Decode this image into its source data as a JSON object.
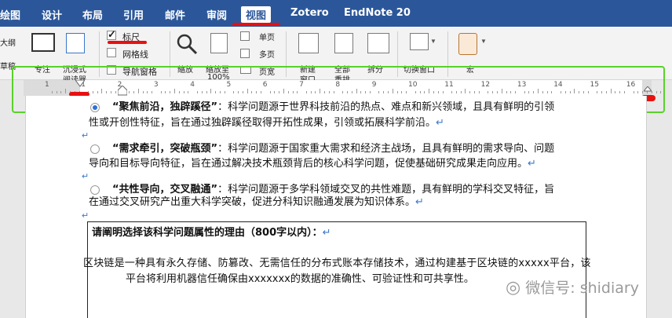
{
  "menu": {
    "items": [
      {
        "id": "draw",
        "label": "绘图"
      },
      {
        "id": "design",
        "label": "设计"
      },
      {
        "id": "layout",
        "label": "布局"
      },
      {
        "id": "references",
        "label": "引用"
      },
      {
        "id": "mailings",
        "label": "邮件"
      },
      {
        "id": "review",
        "label": "审阅"
      },
      {
        "id": "view",
        "label": "视图",
        "active": true
      },
      {
        "id": "zotero",
        "label": "Zotero"
      },
      {
        "id": "endnote",
        "label": "EndNote 20"
      }
    ]
  },
  "ribbon": {
    "outline_partial": "大纲",
    "draft_partial": "草稿",
    "focus": "专注",
    "immersive_reader_l1": "沉浸式",
    "immersive_reader_l2": "阅读器",
    "ruler": {
      "label": "标尺",
      "checked": true
    },
    "gridlines": {
      "label": "网格线",
      "checked": false
    },
    "nav_pane": {
      "label": "导航窗格",
      "checked": false
    },
    "zoom": "缩放",
    "zoom_to_l1": "缩放至",
    "zoom_to_l2": "100%",
    "one_page": "单页",
    "multi_page": "多页",
    "page_width": "页宽",
    "new_window_l1": "新建",
    "new_window_l2": "窗口",
    "arrange_all_l1": "全部",
    "arrange_all_l2": "重排",
    "split": "拆分",
    "switch_windows": "切换窗口",
    "macros": "宏"
  },
  "ruler": {
    "numbers": [
      "1",
      "1",
      "2",
      "3",
      "4",
      "5",
      "6",
      "7",
      "8",
      "9",
      "10",
      "11",
      "12",
      "13",
      "14",
      "15",
      "16"
    ]
  },
  "document": {
    "option1": {
      "title": "“聚焦前沿，独辟蹊径”",
      "line1_rest": "：科学问题源于世界科技前沿的热点、难点和新兴领域，且具有鲜明的引领",
      "line2": "性或开创性特征，旨在通过独辟蹊径取得开拓性成果，引领或拓展科学前沿。",
      "selected": true
    },
    "option2": {
      "title": "“需求牵引，突破瓶颈”",
      "line1_rest": "：科学问题源于国家重大需求和经济主战场，且具有鲜明的需求导向、问题",
      "line2": "导向和目标导向特征，旨在通过解决技术瓶颈背后的核心科学问题，促使基础研究成果走向应用。",
      "selected": false
    },
    "option3": {
      "title": "“共性导向，交叉融通”",
      "line1_rest": "：科学问题源于多学科领域交叉的共性难题，具有鲜明的学科交叉特征，旨",
      "line2": "在通过交叉研究产出重大科学突破，促进分科知识融通发展为知识体系。",
      "selected": false
    },
    "reason_heading": "请阐明选择该科学问题属性的理由（800字以内）：",
    "reason_line1": "区块链是一种具有永久存储、防篡改、无需信任的分布式账本存储技术，通过构建基于区块链的xxxxx平台，该",
    "reason_line2": "平台将利用机器信任确保由xxxxxxx的数据的准确性、可验证性和可共享性。",
    "para_mark": "↵"
  },
  "watermark": "微信号: shidiary",
  "colors": {
    "menubar": "#2b579a",
    "highlight_green": "#5ad12b",
    "annotation_red": "#e81010",
    "radio_selected": "#2e6fd6"
  }
}
